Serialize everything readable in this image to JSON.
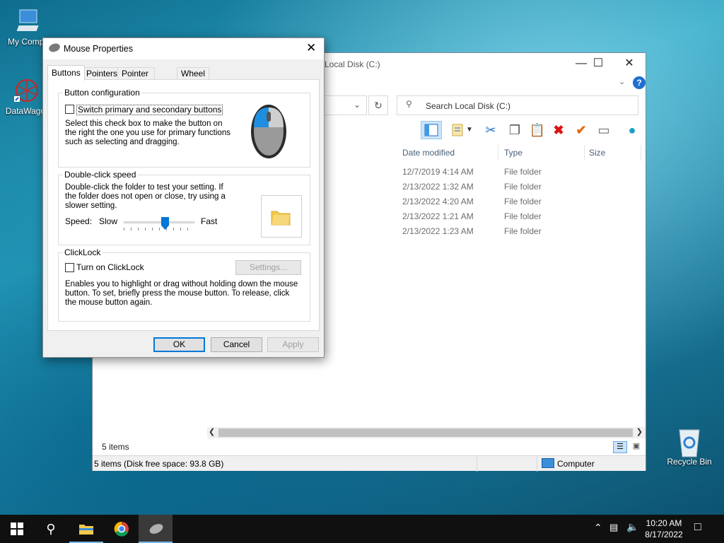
{
  "desktop": {
    "icons": [
      {
        "label": "My Compu",
        "icon": "computer-icon"
      },
      {
        "label": "DataWago",
        "icon": "datawago-icon"
      },
      {
        "label": "Recycle Bin",
        "icon": "recycle-bin-icon"
      }
    ]
  },
  "explorer": {
    "title": "Local Disk (C:)",
    "search_placeholder": "Search Local Disk (C:)",
    "columns": [
      "Date modified",
      "Type",
      "Size"
    ],
    "rows": [
      {
        "date": "12/7/2019 4:14 AM",
        "type": "File folder"
      },
      {
        "date": "2/13/2022 1:32 AM",
        "type": "File folder"
      },
      {
        "date": "2/13/2022 4:20 AM",
        "type": "File folder"
      },
      {
        "date": "2/13/2022 1:21 AM",
        "type": "File folder"
      },
      {
        "date": "2/13/2022 1:23 AM",
        "type": "File folder"
      }
    ],
    "item_count": "5 items",
    "status": "5 items (Disk free space: 93.8 GB)",
    "location": "Computer"
  },
  "dialog": {
    "title": "Mouse Properties",
    "tabs": [
      "Buttons",
      "Pointers",
      "Pointer Options",
      "Wheel"
    ],
    "button_config": {
      "label": "Button configuration",
      "checkbox_label": "Switch primary and secondary buttons",
      "description": "Select this check box to make the button on the right the one you use for primary functions such as selecting and dragging."
    },
    "double_click": {
      "label": "Double-click speed",
      "description": "Double-click the folder to test your setting. If the folder does not open or close, try using a slower setting.",
      "speed_label": "Speed:",
      "slow": "Slow",
      "fast": "Fast",
      "speed_value": 0.6
    },
    "clicklock": {
      "label": "ClickLock",
      "checkbox_label": "Turn on ClickLock",
      "settings_button": "Settings...",
      "description": "Enables you to highlight or drag without holding down the mouse button. To set, briefly press the mouse button. To release, click the mouse button again."
    },
    "ok": "OK",
    "cancel": "Cancel",
    "apply": "Apply"
  },
  "taskbar": {
    "time": "10:20 AM",
    "date": "8/17/2022"
  }
}
